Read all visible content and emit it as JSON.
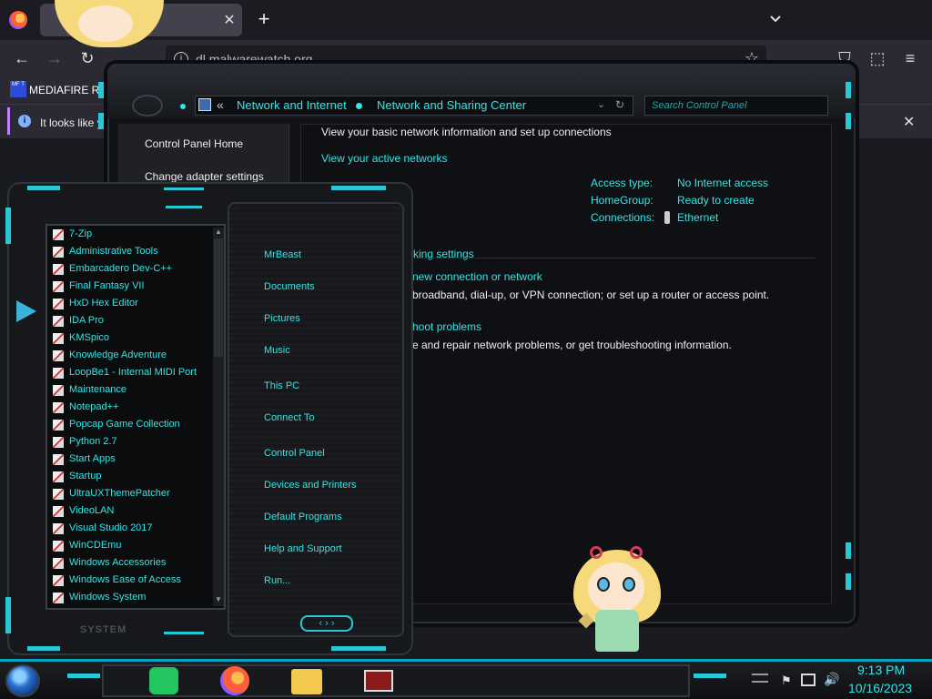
{
  "browser": {
    "tab_close": "✕",
    "new_tab": "+",
    "tab_list": "⌄",
    "url": "dl.malwarewatch.org",
    "bookmark_label": "MEDIAFIRE RO",
    "bookmark_icon_text": "MF T",
    "notification_text": "It looks like y",
    "notification_close": "✕",
    "nav": {
      "back": "←",
      "forward": "→",
      "reload": "↻",
      "star": "☆",
      "pocket": "⛉",
      "extensions": "⬚",
      "menu": "≡"
    }
  },
  "control_panel": {
    "address": {
      "chevron": "«",
      "crumb1": "Network and Internet",
      "crumb2": "Network and Sharing Center",
      "drop": "⌄",
      "refresh": "↻"
    },
    "search_placeholder": "Search Control Panel",
    "sidebar": {
      "home": "Control Panel Home",
      "adapter": "Change adapter settings"
    },
    "heading": "View your basic network information and set up connections",
    "active_networks": "View your active networks",
    "info": [
      {
        "key": "Access type:",
        "value": "No Internet access"
      },
      {
        "key": "HomeGroup:",
        "value": "Ready to create"
      },
      {
        "key": "Connections:",
        "value": "Ethernet"
      }
    ],
    "change_settings": "rking settings",
    "new_connection": "new connection or network",
    "new_connection_desc": "broadband, dial-up, or VPN connection; or set up a router or access point.",
    "troubleshoot": "hoot problems",
    "troubleshoot_desc": "e and repair network problems, or get troubleshooting information."
  },
  "start_menu": {
    "programs": [
      "7-Zip",
      "Administrative Tools",
      "Embarcadero Dev-C++",
      "Final Fantasy VII",
      "HxD Hex Editor",
      "IDA Pro",
      "KMSpico",
      "Knowledge Adventure",
      "LoopBe1 - Internal MIDI Port",
      "Maintenance",
      "Notepad++",
      "Popcap Game Collection",
      "Python 2.7",
      "Start Apps",
      "Startup",
      "UltraUXThemePatcher",
      "VideoLAN",
      "Visual Studio 2017",
      "WinCDEmu",
      "Windows Accessories",
      "Windows Ease of Access",
      "Windows System"
    ],
    "right_links": [
      "MrBeast",
      "Documents",
      "Pictures",
      "Music",
      "This PC",
      "Connect To",
      "Control Panel",
      "Devices and Printers",
      "Default Programs",
      "Help and Support",
      "Run..."
    ],
    "footer_label": "SYSTEM",
    "nav_arrows": "‹ › ›",
    "scroll_up": "▲",
    "scroll_down": "▼"
  },
  "taskbar": {
    "time": "9:13 PM",
    "date": "10/16/2023",
    "tray_flag": "⚑",
    "tray_volume": "🔊"
  },
  "colors": {
    "accent": "#33e6e6",
    "frame": "#29c8d6",
    "bg": "#121317"
  }
}
